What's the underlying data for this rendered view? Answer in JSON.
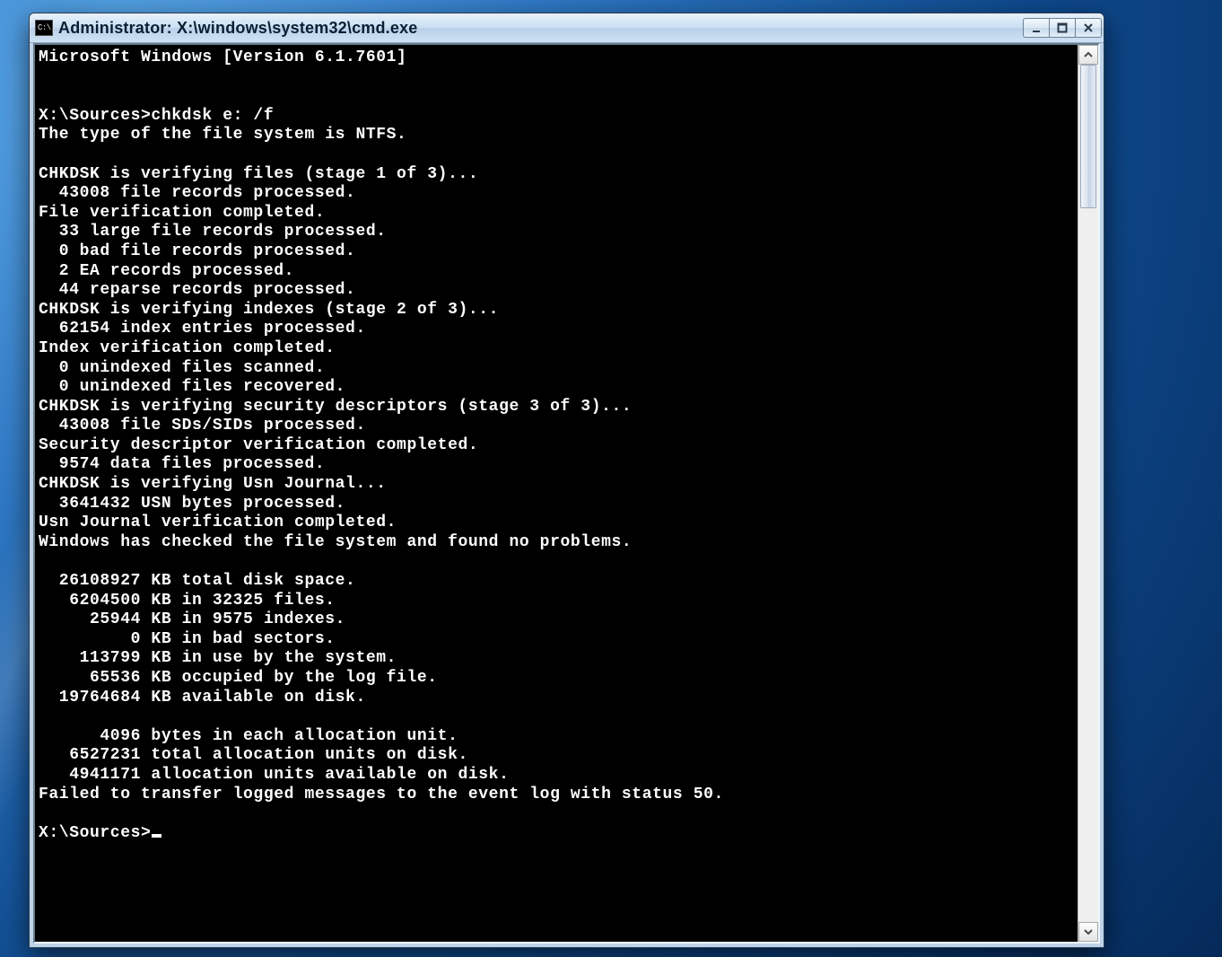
{
  "titlebar": {
    "sysicon_label": "C:\\.",
    "title": "Administrator: X:\\windows\\system32\\cmd.exe"
  },
  "console": {
    "lines": [
      "Microsoft Windows [Version 6.1.7601]",
      "",
      "",
      "X:\\Sources>chkdsk e: /f",
      "The type of the file system is NTFS.",
      "",
      "CHKDSK is verifying files (stage 1 of 3)...",
      "  43008 file records processed.",
      "File verification completed.",
      "  33 large file records processed.",
      "  0 bad file records processed.",
      "  2 EA records processed.",
      "  44 reparse records processed.",
      "CHKDSK is verifying indexes (stage 2 of 3)...",
      "  62154 index entries processed.",
      "Index verification completed.",
      "  0 unindexed files scanned.",
      "  0 unindexed files recovered.",
      "CHKDSK is verifying security descriptors (stage 3 of 3)...",
      "  43008 file SDs/SIDs processed.",
      "Security descriptor verification completed.",
      "  9574 data files processed.",
      "CHKDSK is verifying Usn Journal...",
      "  3641432 USN bytes processed.",
      "Usn Journal verification completed.",
      "Windows has checked the file system and found no problems.",
      "",
      "  26108927 KB total disk space.",
      "   6204500 KB in 32325 files.",
      "     25944 KB in 9575 indexes.",
      "         0 KB in bad sectors.",
      "    113799 KB in use by the system.",
      "     65536 KB occupied by the log file.",
      "  19764684 KB available on disk.",
      "",
      "      4096 bytes in each allocation unit.",
      "   6527231 total allocation units on disk.",
      "   4941171 allocation units available on disk.",
      "Failed to transfer logged messages to the event log with status 50.",
      ""
    ],
    "prompt": "X:\\Sources>"
  }
}
